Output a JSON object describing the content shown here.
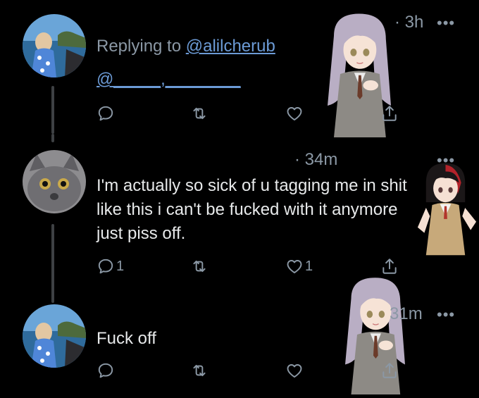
{
  "tweets": [
    {
      "time": "· 3h",
      "reply_label": "Replying to",
      "reply_handle": "@alilcherub",
      "mention": "@_____,________",
      "reply_count": "",
      "like_count": ""
    },
    {
      "time": "· 34m",
      "text": "I'm actually so sick of u tagging me in shit like this i can't be fucked with it anymore just piss off.",
      "reply_count": "1",
      "like_count": "1"
    },
    {
      "time": "31m",
      "text": "Fuck off",
      "reply_count": "",
      "like_count": ""
    }
  ],
  "more_label": "•••",
  "colors": {
    "background": "#000000",
    "text": "#e7e9ea",
    "muted": "#8b98a5",
    "link": "#6c9bd6"
  },
  "icons": [
    "reply-icon",
    "retweet-icon",
    "like-icon",
    "share-icon",
    "more-icon"
  ]
}
